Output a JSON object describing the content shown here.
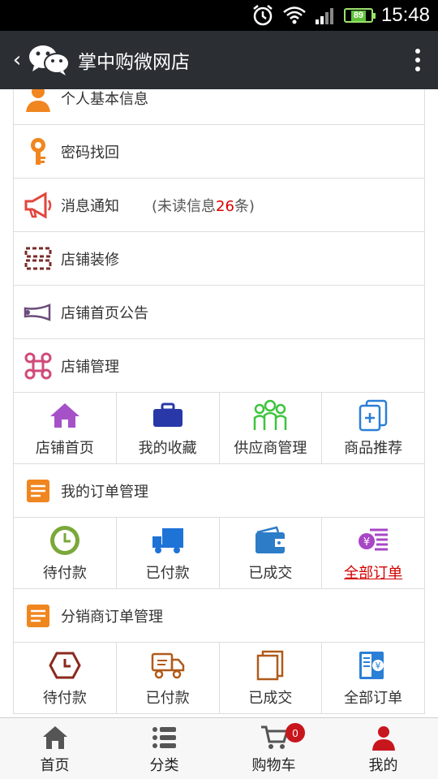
{
  "status_bar": {
    "time": "15:48",
    "battery": "89"
  },
  "header": {
    "title": "掌中购微网店"
  },
  "menu_top": [
    {
      "label": "个人基本信息",
      "icon": "person-icon",
      "color": "#f0861f"
    },
    {
      "label": "密码找回",
      "icon": "key-icon",
      "color": "#f0861f"
    },
    {
      "label": "消息通知",
      "icon": "megaphone-icon",
      "color": "#e2453c",
      "note_prefix": "(未读信息",
      "note_count": "26",
      "note_suffix": "条)"
    },
    {
      "label": "店铺装修",
      "icon": "decoration-icon",
      "color": "#7a2a2a"
    },
    {
      "label": "店铺首页公告",
      "icon": "horn-icon",
      "color": "#6b4c7a"
    },
    {
      "label": "店铺管理",
      "icon": "command-icon",
      "color": "#d04a7a"
    }
  ],
  "shop_grid": [
    {
      "label": "店铺首页",
      "icon": "home-icon",
      "color": "#a552c8"
    },
    {
      "label": "我的收藏",
      "icon": "briefcase-icon",
      "color": "#2838a8"
    },
    {
      "label": "供应商管理",
      "icon": "people-icon",
      "color": "#3cc43c"
    },
    {
      "label": "商品推荐",
      "icon": "cards-icon",
      "color": "#2a7fd6"
    }
  ],
  "my_orders": {
    "label": "我的订单管理",
    "items": [
      {
        "label": "待付款",
        "icon": "clock-icon",
        "color": "#7aa83a"
      },
      {
        "label": "已付款",
        "icon": "truck-icon",
        "color": "#1e73d6"
      },
      {
        "label": "已成交",
        "icon": "wallet-icon",
        "color": "#2d7cc8"
      },
      {
        "label": "全部订单",
        "icon": "yen-list-icon",
        "color": "#a847c6",
        "active": true
      }
    ]
  },
  "distributor_orders": {
    "label": "分销商订单管理",
    "items": [
      {
        "label": "待付款",
        "icon": "clock-outline-icon",
        "color": "#8a2a1e"
      },
      {
        "label": "已付款",
        "icon": "truck-outline-icon",
        "color": "#b05a1a"
      },
      {
        "label": "已成交",
        "icon": "doc-outline-icon",
        "color": "#b05a1a"
      },
      {
        "label": "全部订单",
        "icon": "yen-book-icon",
        "color": "#2a7fd6"
      }
    ]
  },
  "bottom_nav": [
    {
      "label": "首页",
      "icon": "home-icon"
    },
    {
      "label": "分类",
      "icon": "list-icon"
    },
    {
      "label": "购物车",
      "icon": "cart-icon",
      "badge": "0"
    },
    {
      "label": "我的",
      "icon": "user-icon"
    }
  ]
}
